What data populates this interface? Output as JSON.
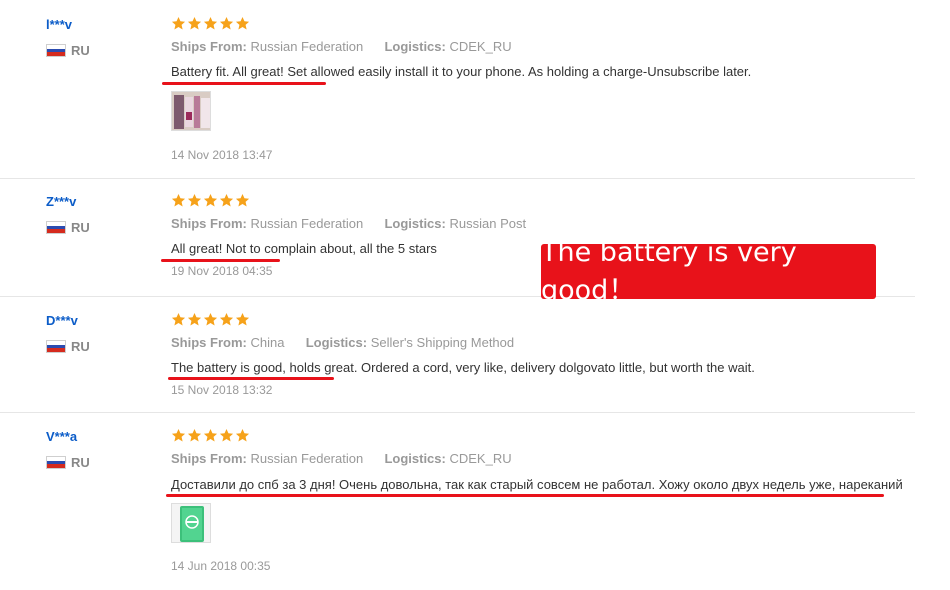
{
  "reviews": [
    {
      "user": "l***v",
      "country": "RU",
      "ships_from_label": "Ships From:",
      "ships_from": "Russian Federation",
      "logistics_label": "Logistics:",
      "logistics": "CDEK_RU",
      "feedback": "Battery fit. All great! Set allowed easily install it to your phone. As holding a charge-Unsubscribe later.",
      "date": "14 Nov 2018 13:47",
      "rating": 5
    },
    {
      "user": "Z***v",
      "country": "RU",
      "ships_from_label": "Ships From:",
      "ships_from": "Russian Federation",
      "logistics_label": "Logistics:",
      "logistics": "Russian Post",
      "feedback": "All great! Not to complain about, all the 5 stars",
      "date": "19 Nov 2018 04:35",
      "rating": 5
    },
    {
      "user": "D***v",
      "country": "RU",
      "ships_from_label": "Ships From:",
      "ships_from": "China",
      "logistics_label": "Logistics:",
      "logistics": "Seller's Shipping Method",
      "feedback": "The battery is good, holds great. Ordered a cord, very like, delivery dolgovato little, but worth the wait.",
      "date": "15 Nov 2018 13:32",
      "rating": 5
    },
    {
      "user": "V***a",
      "country": "RU",
      "ships_from_label": "Ships From:",
      "ships_from": "Russian Federation",
      "logistics_label": "Logistics:",
      "logistics": "CDEK_RU",
      "feedback": "Доставили до спб за 3 дня! Очень довольна, так как старый совсем не работал. Хожу около двух недель уже, нареканий",
      "date": "14 Jun 2018 00:35",
      "rating": 5
    }
  ],
  "callout": "The battery is very good！",
  "colors": {
    "accent_red": "#e8121a",
    "star_orange": "#f6a21a",
    "user_blue": "#0b5cc8"
  },
  "icons": [
    "star-icon",
    "russia-flag-icon"
  ]
}
